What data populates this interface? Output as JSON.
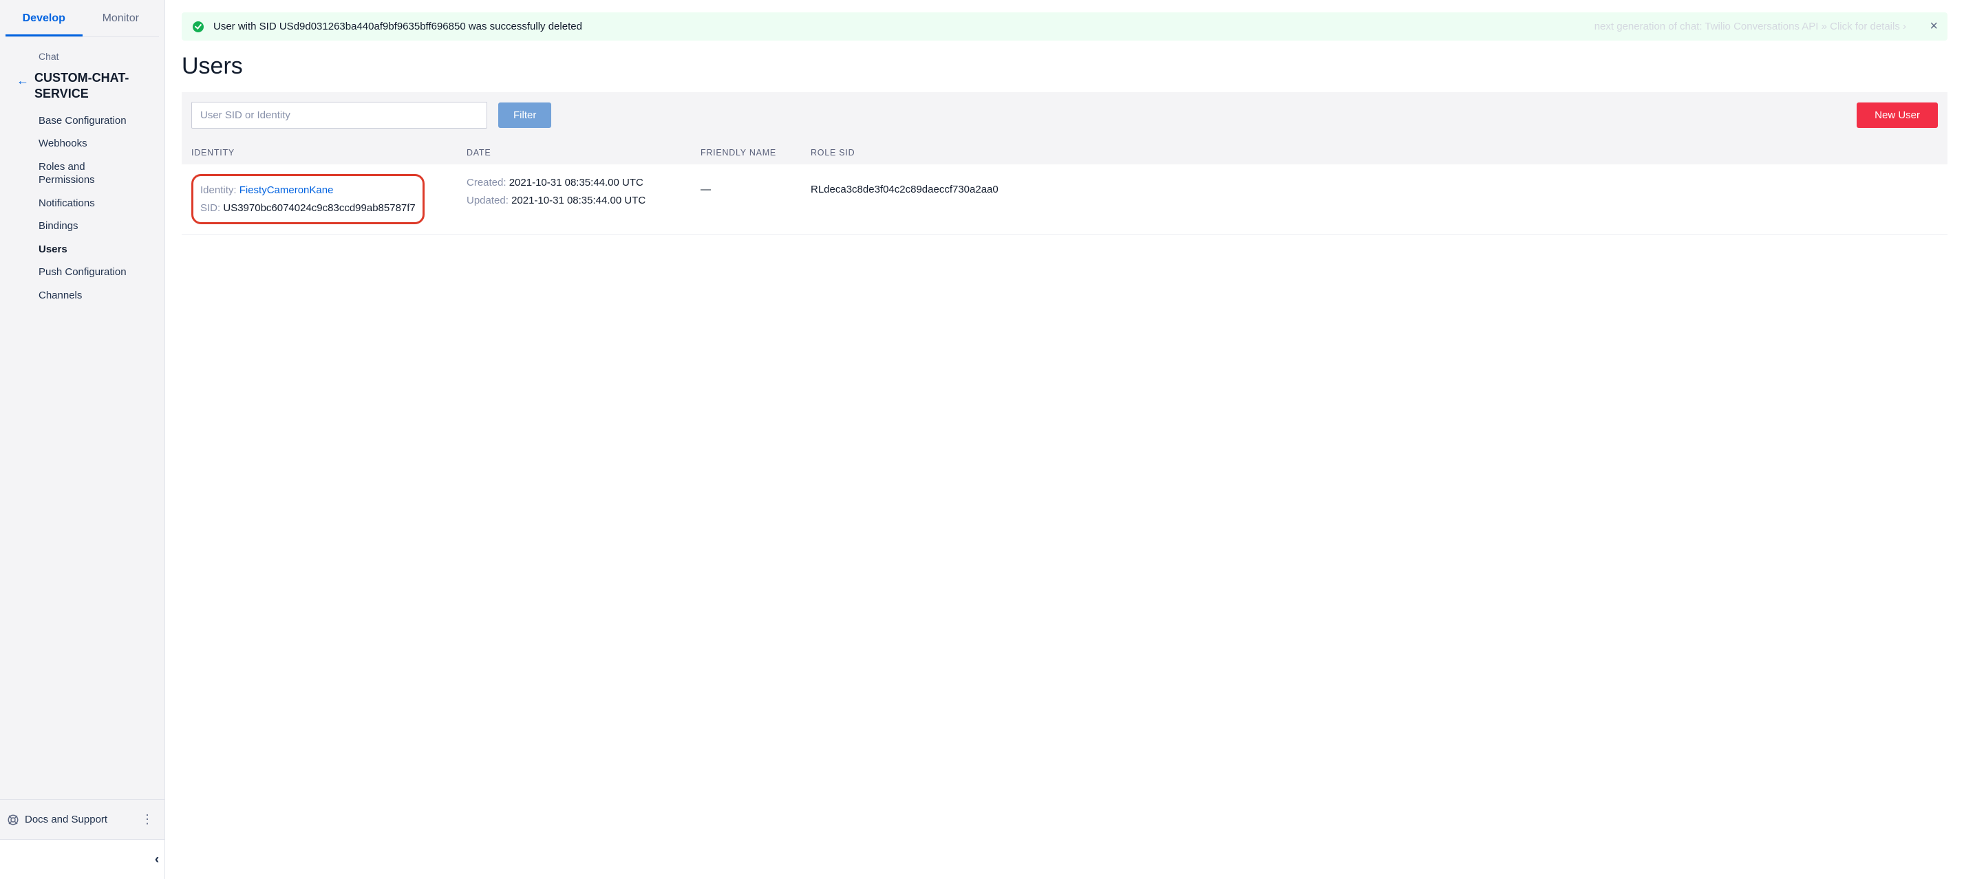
{
  "sidebar": {
    "tab_develop": "Develop",
    "tab_monitor": "Monitor",
    "section_label": "Chat",
    "service_name": "CUSTOM-CHAT-SERVICE",
    "items": [
      {
        "label": "Base Configuration"
      },
      {
        "label": "Webhooks"
      },
      {
        "label": "Roles and Permissions"
      },
      {
        "label": "Notifications"
      },
      {
        "label": "Bindings"
      },
      {
        "label": "Users"
      },
      {
        "label": "Push Configuration"
      },
      {
        "label": "Channels"
      }
    ],
    "docs_label": "Docs and Support"
  },
  "alert": {
    "message": "User with SID USd9d031263ba440af9bf9635bff696850 was successfully deleted",
    "ghost": "next generation of chat: Twilio Conversations API »   Click for details ›"
  },
  "page": {
    "title": "Users"
  },
  "toolbar": {
    "search_placeholder": "User SID or Identity",
    "filter_label": "Filter",
    "new_user_label": "New User"
  },
  "table": {
    "columns": {
      "identity": "IDENTITY",
      "date": "DATE",
      "friendly_name": "FRIENDLY NAME",
      "role_sid": "ROLE SID"
    },
    "row": {
      "identity_label": "Identity:",
      "identity_value": "FiestyCameronKane",
      "sid_label": "SID:",
      "sid_value": "US3970bc6074024c9c83ccd99ab85787f7",
      "created_label": "Created:",
      "created_value": "2021-10-31 08:35:44.00 UTC",
      "updated_label": "Updated:",
      "updated_value": "2021-10-31 08:35:44.00 UTC",
      "friendly_name": "—",
      "role_sid": "RLdeca3c8de3f04c2c89daeccf730a2aa0"
    }
  }
}
